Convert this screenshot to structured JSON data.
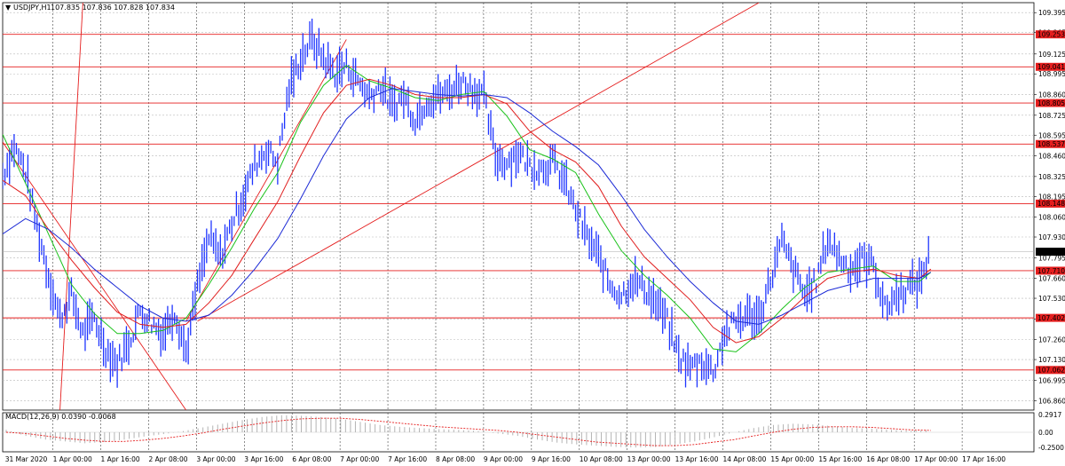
{
  "header": {
    "arrow": "▼",
    "symbol": "USDJPY,H1",
    "quote": "107.835 107.836 107.828 107.834"
  },
  "macd_header": {
    "label": "MACD(12,26,9) 0.0390 -0.0068"
  },
  "colors": {
    "price": "#1f35ff",
    "ma_fast": "#19c219",
    "ma_mid": "#e01e1e",
    "ma_slow": "#1d2bd6",
    "level_line": "#e51e1e",
    "level_tag_bg": "#e51e1e",
    "current_tag_bg": "#000000",
    "grid": "#b8b8b8",
    "macd_hist": "#b4b4b4",
    "macd_signal": "#e51e1e"
  },
  "chart_data": [
    {
      "type": "line",
      "title": "USDJPY,H1",
      "ylim": [
        106.8,
        109.46
      ],
      "yticks": [
        "109.395",
        "109.265",
        "109.125",
        "108.995",
        "108.860",
        "108.725",
        "108.595",
        "108.460",
        "108.325",
        "108.195",
        "108.060",
        "107.930",
        "107.795",
        "107.660",
        "107.530",
        "107.395",
        "107.260",
        "107.130",
        "106.995",
        "106.860"
      ],
      "xticks": [
        "31 Mar 2020",
        "1 Apr 00:00",
        "1 Apr 16:00",
        "2 Apr 08:00",
        "3 Apr 00:00",
        "3 Apr 16:00",
        "6 Apr 08:00",
        "7 Apr 00:00",
        "7 Apr 16:00",
        "8 Apr 08:00",
        "9 Apr 00:00",
        "9 Apr 16:00",
        "10 Apr 08:00",
        "13 Apr 00:00",
        "13 Apr 16:00",
        "14 Apr 08:00",
        "15 Apr 00:00",
        "15 Apr 16:00",
        "16 Apr 08:00",
        "17 Apr 00:00",
        "17 Apr 16:00"
      ],
      "horizontal_levels": [
        "109.253",
        "109.041",
        "108.805",
        "108.537",
        "108.148",
        "107.710",
        "107.402",
        "107.062"
      ],
      "current_price": "107.834",
      "price_path": [
        [
          0,
          108.33
        ],
        [
          1,
          108.52
        ],
        [
          2,
          108.36
        ],
        [
          3,
          108.0
        ],
        [
          4,
          107.68
        ],
        [
          5,
          107.4
        ],
        [
          6,
          107.55
        ],
        [
          7,
          107.3
        ],
        [
          8,
          107.4
        ],
        [
          9,
          107.2
        ],
        [
          10,
          107.1
        ],
        [
          11,
          107.24
        ],
        [
          12,
          107.45
        ],
        [
          13,
          107.37
        ],
        [
          14,
          107.3
        ],
        [
          15,
          107.45
        ],
        [
          16,
          107.18
        ],
        [
          17,
          107.6
        ],
        [
          18,
          107.92
        ],
        [
          19,
          107.8
        ],
        [
          20,
          108.02
        ],
        [
          21,
          108.2
        ],
        [
          22,
          108.4
        ],
        [
          23,
          108.5
        ],
        [
          24,
          108.42
        ],
        [
          25,
          108.9
        ],
        [
          26,
          109.1
        ],
        [
          27,
          109.22
        ],
        [
          28,
          109.1
        ],
        [
          29,
          109.0
        ],
        [
          30,
          109.05
        ],
        [
          31,
          108.95
        ],
        [
          32,
          108.85
        ],
        [
          33,
          108.92
        ],
        [
          34,
          108.78
        ],
        [
          35,
          108.85
        ],
        [
          36,
          108.7
        ],
        [
          37,
          108.82
        ],
        [
          38,
          108.85
        ],
        [
          39,
          108.88
        ],
        [
          40,
          108.95
        ],
        [
          41,
          108.9
        ],
        [
          42,
          108.85
        ],
        [
          43,
          108.45
        ],
        [
          44,
          108.42
        ],
        [
          45,
          108.48
        ],
        [
          46,
          108.4
        ],
        [
          47,
          108.38
        ],
        [
          48,
          108.42
        ],
        [
          49,
          108.3
        ],
        [
          50,
          108.1
        ],
        [
          51,
          107.93
        ],
        [
          52,
          107.8
        ],
        [
          53,
          107.62
        ],
        [
          54,
          107.55
        ],
        [
          55,
          107.65
        ],
        [
          56,
          107.6
        ],
        [
          57,
          107.5
        ],
        [
          58,
          107.38
        ],
        [
          59,
          107.15
        ],
        [
          60,
          107.08
        ],
        [
          61,
          107.12
        ],
        [
          62,
          107.05
        ],
        [
          63,
          107.3
        ],
        [
          64,
          107.38
        ],
        [
          65,
          107.42
        ],
        [
          66,
          107.4
        ],
        [
          67,
          107.65
        ],
        [
          68,
          107.9
        ],
        [
          69,
          107.72
        ],
        [
          70,
          107.55
        ],
        [
          71,
          107.64
        ],
        [
          72,
          107.92
        ],
        [
          73,
          107.8
        ],
        [
          74,
          107.72
        ],
        [
          75,
          107.78
        ],
        [
          76,
          107.75
        ],
        [
          77,
          107.46
        ],
        [
          78,
          107.55
        ],
        [
          79,
          107.6
        ],
        [
          80,
          107.64
        ],
        [
          81,
          107.84
        ]
      ],
      "series": [
        {
          "values": [
            [
              0,
              108.6
            ],
            [
              2,
              108.28
            ],
            [
              4,
              107.95
            ],
            [
              6,
              107.62
            ],
            [
              8,
              107.43
            ],
            [
              10,
              107.3
            ],
            [
              12,
              107.3
            ],
            [
              14,
              107.32
            ],
            [
              16,
              107.4
            ],
            [
              18,
              107.62
            ],
            [
              20,
              107.86
            ],
            [
              22,
              108.12
            ],
            [
              24,
              108.35
            ],
            [
              26,
              108.68
            ],
            [
              28,
              108.92
            ],
            [
              30,
              109.05
            ],
            [
              32,
              108.95
            ],
            [
              34,
              108.9
            ],
            [
              36,
              108.84
            ],
            [
              38,
              108.82
            ],
            [
              40,
              108.86
            ],
            [
              42,
              108.88
            ],
            [
              44,
              108.72
            ],
            [
              46,
              108.5
            ],
            [
              48,
              108.44
            ],
            [
              50,
              108.35
            ],
            [
              52,
              108.08
            ],
            [
              54,
              107.84
            ],
            [
              56,
              107.68
            ],
            [
              58,
              107.55
            ],
            [
              60,
              107.4
            ],
            [
              62,
              107.2
            ],
            [
              64,
              107.18
            ],
            [
              66,
              107.3
            ],
            [
              68,
              107.46
            ],
            [
              70,
              107.6
            ],
            [
              72,
              107.7
            ],
            [
              74,
              107.72
            ],
            [
              76,
              107.74
            ],
            [
              78,
              107.64
            ],
            [
              80,
              107.64
            ],
            [
              81,
              107.7
            ]
          ]
        },
        {
          "values": [
            [
              0,
              108.3
            ],
            [
              2,
              108.2
            ],
            [
              4,
              107.98
            ],
            [
              6,
              107.78
            ],
            [
              8,
              107.6
            ],
            [
              10,
              107.44
            ],
            [
              12,
              107.36
            ],
            [
              14,
              107.34
            ],
            [
              16,
              107.36
            ],
            [
              18,
              107.5
            ],
            [
              20,
              107.68
            ],
            [
              22,
              107.92
            ],
            [
              24,
              108.16
            ],
            [
              26,
              108.46
            ],
            [
              28,
              108.74
            ],
            [
              30,
              108.92
            ],
            [
              32,
              108.96
            ],
            [
              34,
              108.92
            ],
            [
              36,
              108.86
            ],
            [
              38,
              108.84
            ],
            [
              40,
              108.84
            ],
            [
              42,
              108.86
            ],
            [
              44,
              108.8
            ],
            [
              46,
              108.62
            ],
            [
              48,
              108.5
            ],
            [
              50,
              108.42
            ],
            [
              52,
              108.26
            ],
            [
              54,
              108.0
            ],
            [
              56,
              107.8
            ],
            [
              58,
              107.66
            ],
            [
              60,
              107.52
            ],
            [
              62,
              107.34
            ],
            [
              64,
              107.24
            ],
            [
              66,
              107.28
            ],
            [
              68,
              107.4
            ],
            [
              70,
              107.54
            ],
            [
              72,
              107.66
            ],
            [
              74,
              107.7
            ],
            [
              76,
              107.72
            ],
            [
              78,
              107.68
            ],
            [
              80,
              107.66
            ],
            [
              81,
              107.72
            ]
          ]
        },
        {
          "values": [
            [
              0,
              107.95
            ],
            [
              2,
              108.05
            ],
            [
              4,
              107.98
            ],
            [
              6,
              107.86
            ],
            [
              8,
              107.72
            ],
            [
              10,
              107.6
            ],
            [
              12,
              107.48
            ],
            [
              14,
              107.4
            ],
            [
              16,
              107.38
            ],
            [
              18,
              107.42
            ],
            [
              20,
              107.55
            ],
            [
              22,
              107.72
            ],
            [
              24,
              107.92
            ],
            [
              26,
              108.18
            ],
            [
              28,
              108.46
            ],
            [
              30,
              108.7
            ],
            [
              32,
              108.84
            ],
            [
              34,
              108.9
            ],
            [
              36,
              108.88
            ],
            [
              38,
              108.86
            ],
            [
              40,
              108.85
            ],
            [
              42,
              108.86
            ],
            [
              44,
              108.84
            ],
            [
              46,
              108.74
            ],
            [
              48,
              108.62
            ],
            [
              50,
              108.52
            ],
            [
              52,
              108.4
            ],
            [
              54,
              108.2
            ],
            [
              56,
              107.98
            ],
            [
              58,
              107.8
            ],
            [
              60,
              107.64
            ],
            [
              62,
              107.5
            ],
            [
              64,
              107.38
            ],
            [
              66,
              107.36
            ],
            [
              68,
              107.42
            ],
            [
              70,
              107.5
            ],
            [
              72,
              107.58
            ],
            [
              74,
              107.62
            ],
            [
              76,
              107.66
            ],
            [
              78,
              107.66
            ],
            [
              80,
              107.66
            ],
            [
              81,
              107.7
            ]
          ]
        }
      ],
      "trendlines": [
        {
          "from": [
            0,
            108.55
          ],
          "to": [
            16,
            106.8
          ]
        },
        {
          "from": [
            16,
            107.38
          ],
          "to": [
            30,
            109.22
          ]
        },
        {
          "from": [
            17,
            107.38
          ],
          "to": [
            66,
            109.46
          ]
        },
        {
          "from": [
            5,
            106.8
          ],
          "to": [
            7,
            109.46
          ]
        }
      ]
    },
    {
      "type": "bar",
      "title": "MACD(12,26,9) 0.0390 -0.0068",
      "ylim": [
        -0.32,
        0.32
      ],
      "yticks": [
        "0.2917",
        "0.00",
        "-0.2500"
      ],
      "values": [
        0.04,
        -0.06,
        -0.12,
        -0.15,
        -0.18,
        -0.16,
        -0.12,
        -0.07,
        -0.03,
        0.02,
        0.08,
        0.14,
        0.2,
        0.25,
        0.28,
        0.27,
        0.25,
        0.22,
        0.17,
        0.12,
        0.09,
        0.07,
        0.05,
        0.04,
        0.02,
        -0.02,
        -0.06,
        -0.12,
        -0.17,
        -0.2,
        -0.22,
        -0.24,
        -0.25,
        -0.24,
        -0.2,
        -0.15,
        -0.08,
        0.0,
        0.07,
        0.12,
        0.14,
        0.13,
        0.1,
        0.07,
        0.06,
        0.04,
        0.02,
        0.04
      ],
      "signal": [
        0.0,
        -0.02,
        -0.06,
        -0.1,
        -0.13,
        -0.15,
        -0.15,
        -0.13,
        -0.1,
        -0.06,
        -0.01,
        0.05,
        0.1,
        0.15,
        0.19,
        0.22,
        0.23,
        0.23,
        0.21,
        0.18,
        0.15,
        0.12,
        0.09,
        0.07,
        0.05,
        0.03,
        0.0,
        -0.04,
        -0.08,
        -0.12,
        -0.16,
        -0.18,
        -0.2,
        -0.22,
        -0.22,
        -0.2,
        -0.16,
        -0.12,
        -0.06,
        0.0,
        0.05,
        0.08,
        0.09,
        0.09,
        0.08,
        0.06,
        0.04,
        0.03
      ]
    }
  ]
}
